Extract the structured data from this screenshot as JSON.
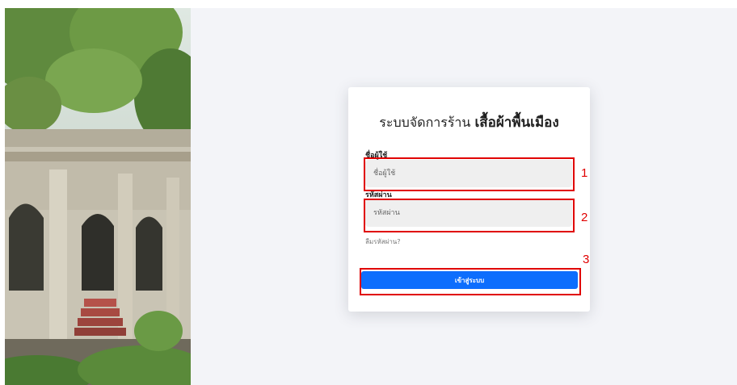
{
  "login": {
    "title_prefix": "ระบบจัดการร้าน",
    "title_brand": "เสื้อผ้าพื้นเมือง",
    "username_label": "ชื่อผู้ใช้",
    "username_placeholder": "ชื่อผู้ใช้",
    "password_label": "รหัสผ่าน",
    "password_placeholder": "รหัสผ่าน",
    "forgot_password": "ลืมรหัสผ่าน?",
    "submit_label": "เข้าสู่ระบบ"
  },
  "annotations": [
    {
      "label": "1",
      "target": "username-input"
    },
    {
      "label": "2",
      "target": "password-input"
    },
    {
      "label": "3",
      "target": "login-button"
    }
  ],
  "colors": {
    "primary": "#0d6efd",
    "annotation": "#e00000",
    "background": "#f3f4f8",
    "input_bg": "#efefef"
  }
}
